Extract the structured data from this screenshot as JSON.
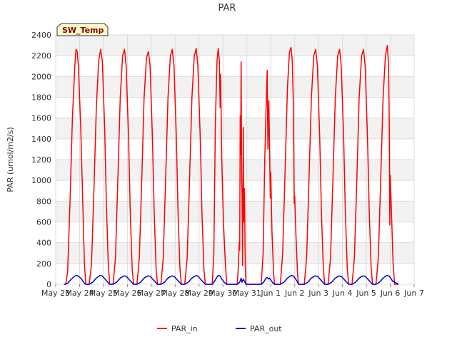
{
  "chart_data": {
    "type": "line",
    "title": "PAR",
    "ylabel": "PAR (umol/m2/s)",
    "xlabel": "",
    "ylim": [
      0,
      2400
    ],
    "yticks": [
      0,
      200,
      400,
      600,
      800,
      1000,
      1200,
      1400,
      1600,
      1800,
      2000,
      2200,
      2400
    ],
    "xlim": [
      0,
      15
    ],
    "xticks": [
      {
        "x": 0,
        "label": "May 23"
      },
      {
        "x": 1,
        "label": "May 24"
      },
      {
        "x": 2,
        "label": "May 25"
      },
      {
        "x": 3,
        "label": "May 26"
      },
      {
        "x": 4,
        "label": "May 27"
      },
      {
        "x": 5,
        "label": "May 28"
      },
      {
        "x": 6,
        "label": "May 29"
      },
      {
        "x": 7,
        "label": "May 30"
      },
      {
        "x": 8,
        "label": "May 31"
      },
      {
        "x": 9,
        "label": "Jun 1"
      },
      {
        "x": 10,
        "label": "Jun 2"
      },
      {
        "x": 11,
        "label": "Jun 3"
      },
      {
        "x": 12,
        "label": "Jun 4"
      },
      {
        "x": 13,
        "label": "Jun 5"
      },
      {
        "x": 14,
        "label": "Jun 6"
      },
      {
        "x": 15,
        "label": "Jun 7"
      }
    ],
    "grid": true,
    "legend_position": "bottom-center",
    "badge": "SW_Temp",
    "series": [
      {
        "name": "PAR_in",
        "color": "#ff0000",
        "points": [
          [
            0.35,
            0
          ],
          [
            0.42,
            0
          ],
          [
            0.5,
            120
          ],
          [
            0.6,
            800
          ],
          [
            0.7,
            1600
          ],
          [
            0.8,
            2100
          ],
          [
            0.85,
            2260
          ],
          [
            0.9,
            2240
          ],
          [
            0.95,
            2100
          ],
          [
            1.05,
            1500
          ],
          [
            1.12,
            900
          ],
          [
            1.2,
            200
          ],
          [
            1.26,
            0
          ],
          [
            1.4,
            0
          ],
          [
            1.5,
            200
          ],
          [
            1.6,
            900
          ],
          [
            1.7,
            1700
          ],
          [
            1.8,
            2150
          ],
          [
            1.88,
            2260
          ],
          [
            1.95,
            2150
          ],
          [
            2.05,
            1500
          ],
          [
            2.12,
            800
          ],
          [
            2.2,
            200
          ],
          [
            2.26,
            0
          ],
          [
            2.4,
            0
          ],
          [
            2.5,
            250
          ],
          [
            2.6,
            1000
          ],
          [
            2.7,
            1800
          ],
          [
            2.8,
            2200
          ],
          [
            2.88,
            2260
          ],
          [
            2.95,
            2100
          ],
          [
            3.05,
            1400
          ],
          [
            3.12,
            700
          ],
          [
            3.2,
            150
          ],
          [
            3.26,
            0
          ],
          [
            3.4,
            0
          ],
          [
            3.5,
            250
          ],
          [
            3.6,
            1000
          ],
          [
            3.7,
            1800
          ],
          [
            3.8,
            2180
          ],
          [
            3.88,
            2240
          ],
          [
            3.95,
            2100
          ],
          [
            4.05,
            1400
          ],
          [
            4.12,
            700
          ],
          [
            4.2,
            150
          ],
          [
            4.26,
            0
          ],
          [
            4.4,
            0
          ],
          [
            4.5,
            250
          ],
          [
            4.6,
            1000
          ],
          [
            4.7,
            1800
          ],
          [
            4.8,
            2200
          ],
          [
            4.88,
            2260
          ],
          [
            4.95,
            2100
          ],
          [
            5.05,
            1400
          ],
          [
            5.12,
            700
          ],
          [
            5.2,
            150
          ],
          [
            5.26,
            0
          ],
          [
            5.4,
            0
          ],
          [
            5.5,
            250
          ],
          [
            5.6,
            1000
          ],
          [
            5.7,
            1800
          ],
          [
            5.8,
            2200
          ],
          [
            5.88,
            2270
          ],
          [
            5.95,
            2100
          ],
          [
            6.05,
            1400
          ],
          [
            6.12,
            700
          ],
          [
            6.2,
            150
          ],
          [
            6.26,
            0
          ],
          [
            6.55,
            0
          ],
          [
            6.62,
            300
          ],
          [
            6.68,
            1550
          ],
          [
            6.75,
            2150
          ],
          [
            6.8,
            2270
          ],
          [
            6.85,
            2150
          ],
          [
            6.88,
            1700
          ],
          [
            6.9,
            2020
          ],
          [
            6.95,
            1200
          ],
          [
            7.02,
            600
          ],
          [
            7.1,
            200
          ],
          [
            7.16,
            0
          ],
          [
            7.6,
            0
          ],
          [
            7.65,
            200
          ],
          [
            7.68,
            400
          ],
          [
            7.7,
            330
          ],
          [
            7.72,
            1620
          ],
          [
            7.74,
            1250
          ],
          [
            7.76,
            2140
          ],
          [
            7.78,
            1000
          ],
          [
            7.8,
            850
          ],
          [
            7.82,
            180
          ],
          [
            7.85,
            1510
          ],
          [
            7.87,
            600
          ],
          [
            7.9,
            920
          ],
          [
            7.93,
            200
          ],
          [
            7.96,
            0
          ],
          [
            8.6,
            0
          ],
          [
            8.68,
            300
          ],
          [
            8.75,
            1200
          ],
          [
            8.8,
            1660
          ],
          [
            8.85,
            2060
          ],
          [
            8.88,
            1300
          ],
          [
            8.92,
            1770
          ],
          [
            8.95,
            1310
          ],
          [
            8.98,
            830
          ],
          [
            9.0,
            1080
          ],
          [
            9.05,
            500
          ],
          [
            9.12,
            100
          ],
          [
            9.16,
            0
          ],
          [
            9.4,
            0
          ],
          [
            9.5,
            300
          ],
          [
            9.6,
            1100
          ],
          [
            9.7,
            1900
          ],
          [
            9.78,
            2230
          ],
          [
            9.85,
            2280
          ],
          [
            9.9,
            2150
          ],
          [
            9.95,
            1700
          ],
          [
            9.98,
            780
          ],
          [
            10.0,
            850
          ],
          [
            10.05,
            500
          ],
          [
            10.12,
            100
          ],
          [
            10.16,
            0
          ],
          [
            10.4,
            0
          ],
          [
            10.5,
            250
          ],
          [
            10.6,
            1000
          ],
          [
            10.7,
            1800
          ],
          [
            10.8,
            2200
          ],
          [
            10.88,
            2260
          ],
          [
            10.95,
            2100
          ],
          [
            11.05,
            1400
          ],
          [
            11.12,
            700
          ],
          [
            11.2,
            150
          ],
          [
            11.26,
            0
          ],
          [
            11.4,
            0
          ],
          [
            11.5,
            250
          ],
          [
            11.6,
            1000
          ],
          [
            11.7,
            1800
          ],
          [
            11.8,
            2200
          ],
          [
            11.88,
            2260
          ],
          [
            11.95,
            2100
          ],
          [
            12.05,
            1400
          ],
          [
            12.12,
            700
          ],
          [
            12.2,
            150
          ],
          [
            12.26,
            0
          ],
          [
            12.4,
            0
          ],
          [
            12.5,
            250
          ],
          [
            12.6,
            1000
          ],
          [
            12.7,
            1800
          ],
          [
            12.8,
            2200
          ],
          [
            12.88,
            2260
          ],
          [
            12.95,
            2100
          ],
          [
            13.05,
            1400
          ],
          [
            13.12,
            700
          ],
          [
            13.2,
            150
          ],
          [
            13.26,
            0
          ],
          [
            13.4,
            0
          ],
          [
            13.5,
            250
          ],
          [
            13.6,
            1000
          ],
          [
            13.7,
            1800
          ],
          [
            13.8,
            2200
          ],
          [
            13.88,
            2300
          ],
          [
            13.93,
            2100
          ],
          [
            13.96,
            1500
          ],
          [
            13.98,
            570
          ],
          [
            14.0,
            1050
          ],
          [
            14.05,
            700
          ],
          [
            14.12,
            200
          ],
          [
            14.18,
            0
          ],
          [
            14.35,
            0
          ]
        ]
      },
      {
        "name": "PAR_out",
        "color": "#0000cc",
        "points": [
          [
            0.35,
            0
          ],
          [
            0.5,
            10
          ],
          [
            0.65,
            50
          ],
          [
            0.8,
            80
          ],
          [
            0.9,
            85
          ],
          [
            1.05,
            60
          ],
          [
            1.2,
            10
          ],
          [
            1.26,
            0
          ],
          [
            1.4,
            0
          ],
          [
            1.55,
            20
          ],
          [
            1.7,
            60
          ],
          [
            1.85,
            85
          ],
          [
            1.95,
            80
          ],
          [
            2.1,
            40
          ],
          [
            2.26,
            0
          ],
          [
            2.4,
            0
          ],
          [
            2.55,
            20
          ],
          [
            2.7,
            60
          ],
          [
            2.85,
            80
          ],
          [
            2.95,
            78
          ],
          [
            3.1,
            40
          ],
          [
            3.26,
            0
          ],
          [
            3.4,
            0
          ],
          [
            3.55,
            20
          ],
          [
            3.7,
            60
          ],
          [
            3.85,
            80
          ],
          [
            3.95,
            78
          ],
          [
            4.1,
            40
          ],
          [
            4.26,
            0
          ],
          [
            4.4,
            0
          ],
          [
            4.55,
            20
          ],
          [
            4.7,
            60
          ],
          [
            4.85,
            80
          ],
          [
            4.95,
            78
          ],
          [
            5.1,
            40
          ],
          [
            5.26,
            0
          ],
          [
            5.4,
            0
          ],
          [
            5.55,
            20
          ],
          [
            5.7,
            60
          ],
          [
            5.85,
            82
          ],
          [
            5.95,
            80
          ],
          [
            6.1,
            40
          ],
          [
            6.26,
            0
          ],
          [
            6.55,
            0
          ],
          [
            6.65,
            30
          ],
          [
            6.75,
            70
          ],
          [
            6.8,
            85
          ],
          [
            6.88,
            80
          ],
          [
            6.95,
            50
          ],
          [
            7.05,
            20
          ],
          [
            7.16,
            0
          ],
          [
            7.6,
            0
          ],
          [
            7.7,
            20
          ],
          [
            7.76,
            60
          ],
          [
            7.8,
            20
          ],
          [
            7.85,
            50
          ],
          [
            7.9,
            30
          ],
          [
            7.96,
            0
          ],
          [
            8.6,
            0
          ],
          [
            8.7,
            20
          ],
          [
            8.8,
            60
          ],
          [
            8.85,
            65
          ],
          [
            8.9,
            50
          ],
          [
            8.95,
            60
          ],
          [
            9.0,
            40
          ],
          [
            9.1,
            10
          ],
          [
            9.16,
            0
          ],
          [
            9.4,
            0
          ],
          [
            9.55,
            20
          ],
          [
            9.7,
            60
          ],
          [
            9.85,
            85
          ],
          [
            9.95,
            80
          ],
          [
            10.1,
            30
          ],
          [
            10.16,
            0
          ],
          [
            10.4,
            0
          ],
          [
            10.55,
            20
          ],
          [
            10.7,
            60
          ],
          [
            10.85,
            80
          ],
          [
            10.95,
            78
          ],
          [
            11.1,
            40
          ],
          [
            11.26,
            0
          ],
          [
            11.4,
            0
          ],
          [
            11.55,
            20
          ],
          [
            11.7,
            60
          ],
          [
            11.85,
            80
          ],
          [
            11.95,
            78
          ],
          [
            12.1,
            40
          ],
          [
            12.26,
            0
          ],
          [
            12.4,
            0
          ],
          [
            12.55,
            20
          ],
          [
            12.7,
            60
          ],
          [
            12.85,
            80
          ],
          [
            12.95,
            78
          ],
          [
            13.1,
            40
          ],
          [
            13.26,
            0
          ],
          [
            13.4,
            0
          ],
          [
            13.55,
            20
          ],
          [
            13.7,
            60
          ],
          [
            13.85,
            85
          ],
          [
            13.95,
            80
          ],
          [
            14.1,
            30
          ],
          [
            14.35,
            0
          ]
        ]
      }
    ]
  }
}
